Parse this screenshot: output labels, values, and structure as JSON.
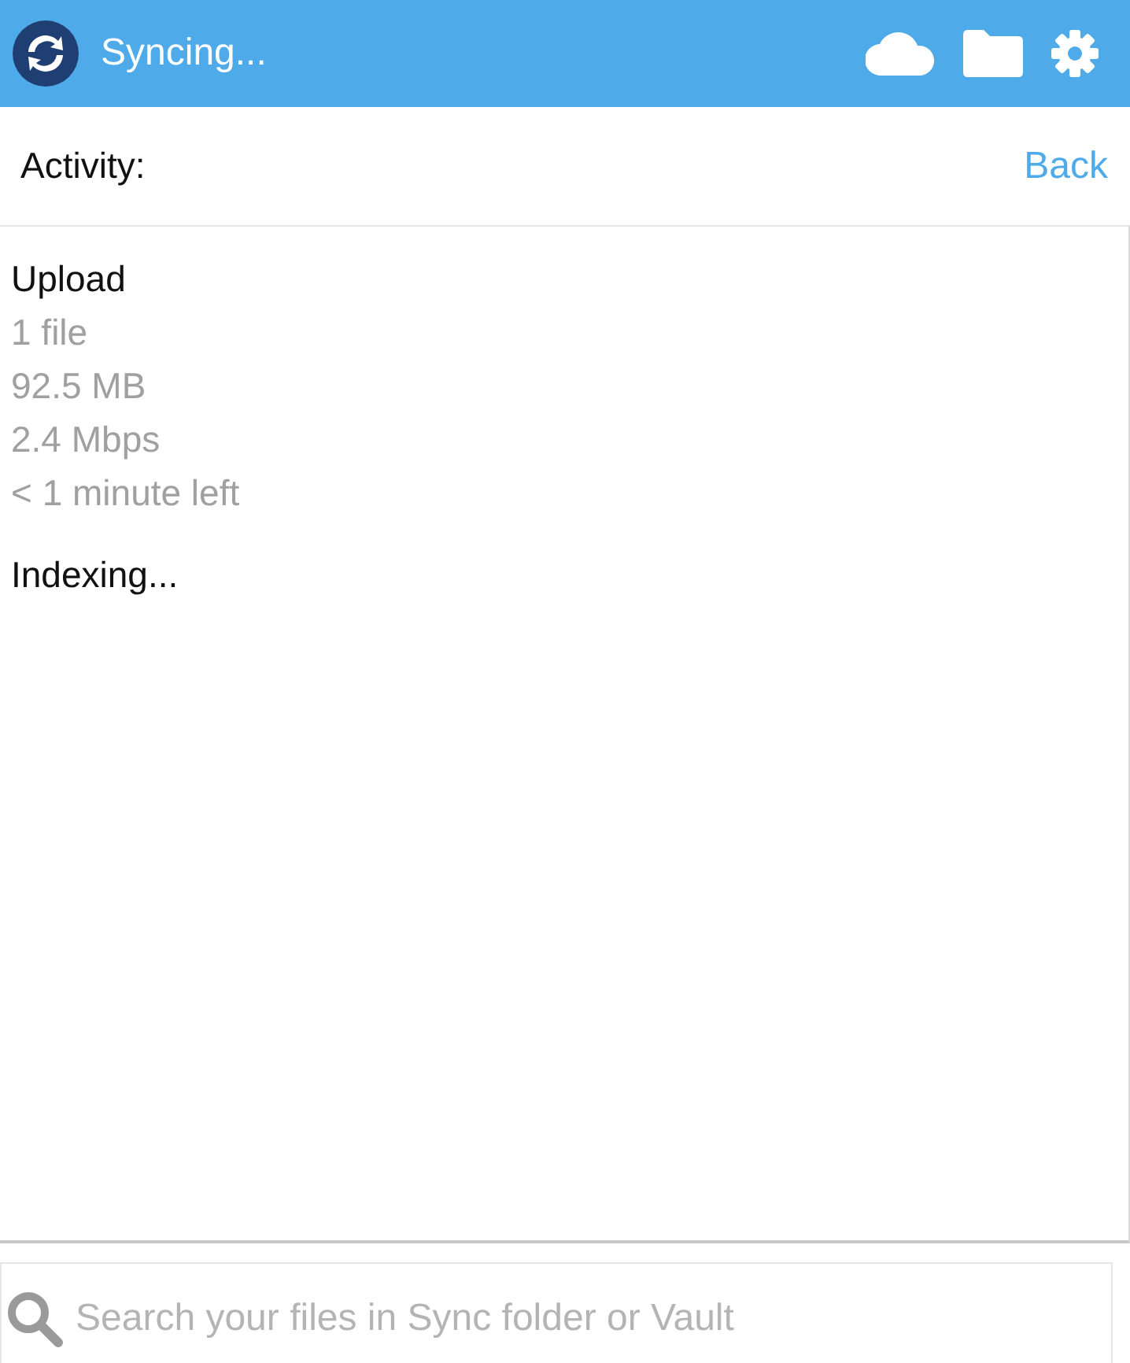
{
  "header": {
    "title": "Syncing..."
  },
  "activity_bar": {
    "label": "Activity:",
    "back": "Back"
  },
  "activities": [
    {
      "title": "Upload",
      "details": [
        "1 file",
        "92.5 MB",
        "2.4 Mbps",
        "< 1 minute left"
      ]
    },
    {
      "title": "Indexing..."
    }
  ],
  "search": {
    "placeholder": "Search your files in Sync folder or Vault"
  }
}
